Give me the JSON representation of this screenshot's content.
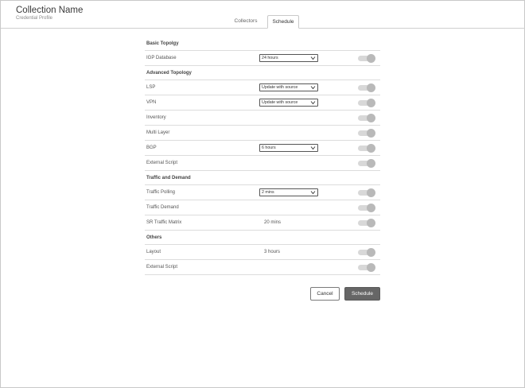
{
  "header": {
    "title": "Collection Name",
    "subtitle": "Credential Profile"
  },
  "tabs": [
    {
      "label": "Collectors",
      "active": false
    },
    {
      "label": "Schedule",
      "active": true
    }
  ],
  "sections": {
    "basic": "Basic Topolgy",
    "advanced": "Advanced Topology",
    "traffic": "Traffic and Demand",
    "others": "Others"
  },
  "rows": {
    "igp": {
      "label": "IGP Database",
      "value": "24 hours"
    },
    "lsp": {
      "label": "LSP",
      "value": "Update with source"
    },
    "vpn": {
      "label": "VPN",
      "value": "Update with source"
    },
    "inventory": {
      "label": "Inventory"
    },
    "multilayer": {
      "label": "Multi Layer"
    },
    "bgp": {
      "label": "BGP",
      "value": "6 hours"
    },
    "ext1": {
      "label": "External Script"
    },
    "polling": {
      "label": "Traffic Polling",
      "value": "2 mins"
    },
    "demand": {
      "label": "Traffic Demand"
    },
    "srmatrix": {
      "label": "SR Traffic Matrix",
      "value": "20 mins"
    },
    "layout": {
      "label": "Layout",
      "value": "3 hours"
    },
    "ext2": {
      "label": "External Script"
    }
  },
  "toggle_state": "on-disabled",
  "buttons": {
    "cancel": "Cancel",
    "schedule": "Schedule"
  },
  "colors": {
    "primary_button": "#666666",
    "toggle_track": "#d8d8d8",
    "toggle_knob": "#b9b9b9"
  }
}
